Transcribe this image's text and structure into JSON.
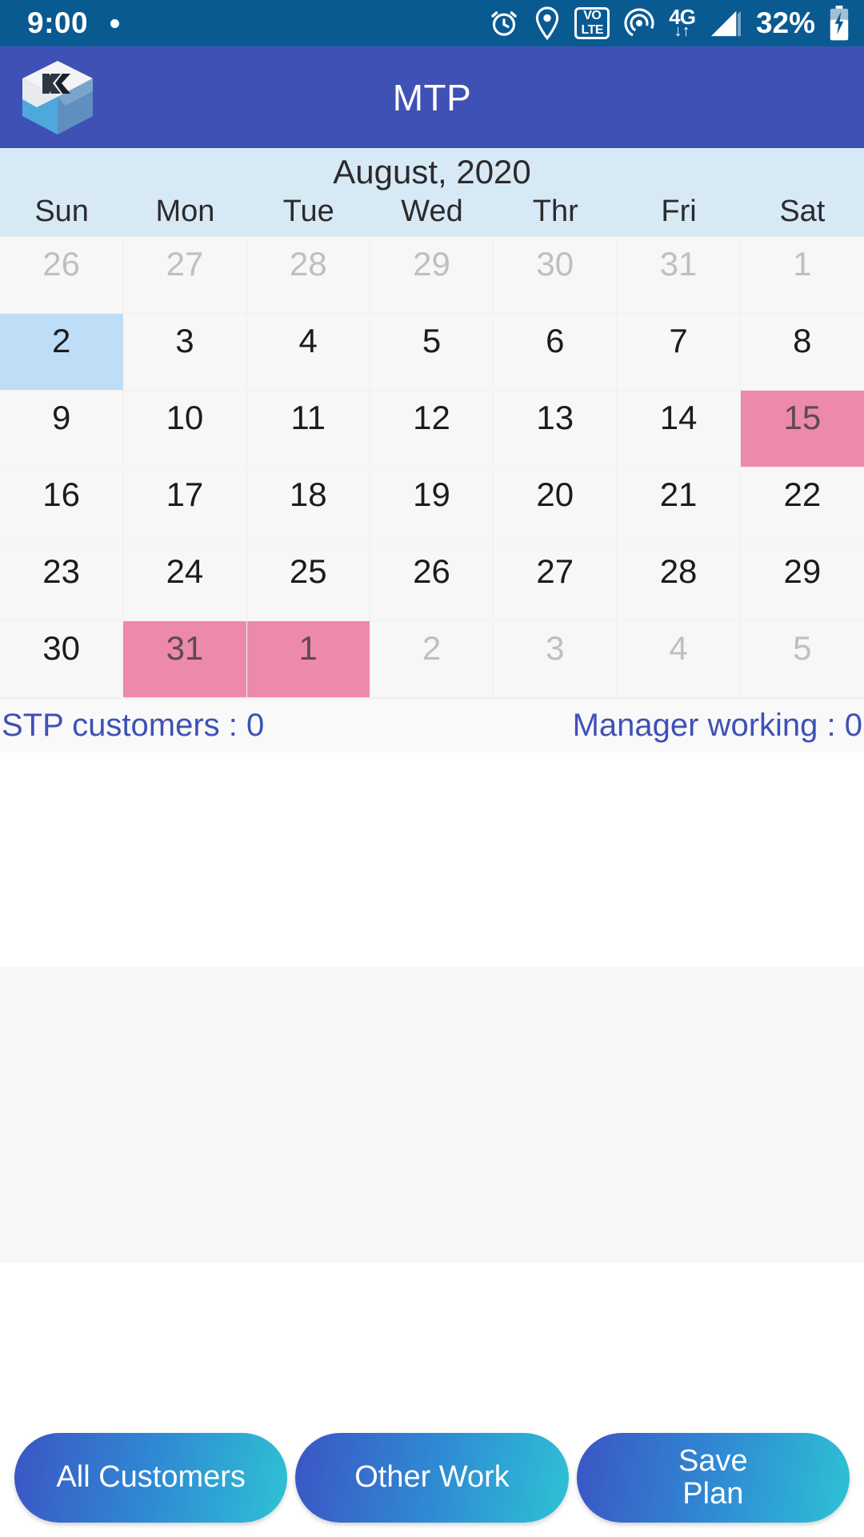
{
  "status_bar": {
    "time": "9:00",
    "battery_percent": "32%",
    "network_type": "4G",
    "network_arrows": "↓↑",
    "volte_top": "VO",
    "volte_bottom": "LTE",
    "icons": [
      "alarm-clock-icon",
      "location-pin-icon",
      "volte-icon",
      "hotspot-icon",
      "mobile-data-icon",
      "signal-bars-icon",
      "battery-charging-icon"
    ],
    "background_color": "#0A5A92"
  },
  "app_bar": {
    "title": "MTP",
    "logo_name": "kaeser-k-cube-logo",
    "background_color": "#3F51B5"
  },
  "calendar": {
    "month_label": "August, 2020",
    "header_background": "#D8E9F6",
    "weekdays": [
      "Sun",
      "Mon",
      "Tue",
      "Wed",
      "Thr",
      "Fri",
      "Sat"
    ],
    "selected_color": "#BEDDF7",
    "planned_color": "#ED89AD",
    "muted_color": "#BFBFBF",
    "weeks": [
      [
        {
          "day": "26",
          "muted": true,
          "state": "none"
        },
        {
          "day": "27",
          "muted": true,
          "state": "none"
        },
        {
          "day": "28",
          "muted": true,
          "state": "none"
        },
        {
          "day": "29",
          "muted": true,
          "state": "none"
        },
        {
          "day": "30",
          "muted": true,
          "state": "none"
        },
        {
          "day": "31",
          "muted": true,
          "state": "none"
        },
        {
          "day": "1",
          "muted": true,
          "state": "none"
        }
      ],
      [
        {
          "day": "2",
          "muted": false,
          "state": "selected"
        },
        {
          "day": "3",
          "muted": false,
          "state": "none"
        },
        {
          "day": "4",
          "muted": false,
          "state": "none"
        },
        {
          "day": "5",
          "muted": false,
          "state": "none"
        },
        {
          "day": "6",
          "muted": false,
          "state": "none"
        },
        {
          "day": "7",
          "muted": false,
          "state": "none"
        },
        {
          "day": "8",
          "muted": false,
          "state": "none"
        }
      ],
      [
        {
          "day": "9",
          "muted": false,
          "state": "none"
        },
        {
          "day": "10",
          "muted": false,
          "state": "none"
        },
        {
          "day": "11",
          "muted": false,
          "state": "none"
        },
        {
          "day": "12",
          "muted": false,
          "state": "none"
        },
        {
          "day": "13",
          "muted": false,
          "state": "none"
        },
        {
          "day": "14",
          "muted": false,
          "state": "none"
        },
        {
          "day": "15",
          "muted": false,
          "state": "planned"
        }
      ],
      [
        {
          "day": "16",
          "muted": false,
          "state": "none"
        },
        {
          "day": "17",
          "muted": false,
          "state": "none"
        },
        {
          "day": "18",
          "muted": false,
          "state": "none"
        },
        {
          "day": "19",
          "muted": false,
          "state": "none"
        },
        {
          "day": "20",
          "muted": false,
          "state": "none"
        },
        {
          "day": "21",
          "muted": false,
          "state": "none"
        },
        {
          "day": "22",
          "muted": false,
          "state": "none"
        }
      ],
      [
        {
          "day": "23",
          "muted": false,
          "state": "none"
        },
        {
          "day": "24",
          "muted": false,
          "state": "none"
        },
        {
          "day": "25",
          "muted": false,
          "state": "none"
        },
        {
          "day": "26",
          "muted": false,
          "state": "none"
        },
        {
          "day": "27",
          "muted": false,
          "state": "none"
        },
        {
          "day": "28",
          "muted": false,
          "state": "none"
        },
        {
          "day": "29",
          "muted": false,
          "state": "none"
        }
      ],
      [
        {
          "day": "30",
          "muted": false,
          "state": "none"
        },
        {
          "day": "31",
          "muted": false,
          "state": "planned"
        },
        {
          "day": "1",
          "muted": true,
          "state": "planned"
        },
        {
          "day": "2",
          "muted": true,
          "state": "none"
        },
        {
          "day": "3",
          "muted": true,
          "state": "none"
        },
        {
          "day": "4",
          "muted": true,
          "state": "none"
        },
        {
          "day": "5",
          "muted": true,
          "state": "none"
        }
      ]
    ]
  },
  "counts": {
    "stp_customers": "STP customers : 0",
    "manager_working": "Manager working : 0",
    "text_color": "#3F51B5"
  },
  "bottom_actions": {
    "all_customers": "All Customers",
    "other_work": "Other Work",
    "save_plan": "Save\nPlan",
    "gradient_start": "#3B55C4",
    "gradient_end": "#2EC2D4"
  }
}
